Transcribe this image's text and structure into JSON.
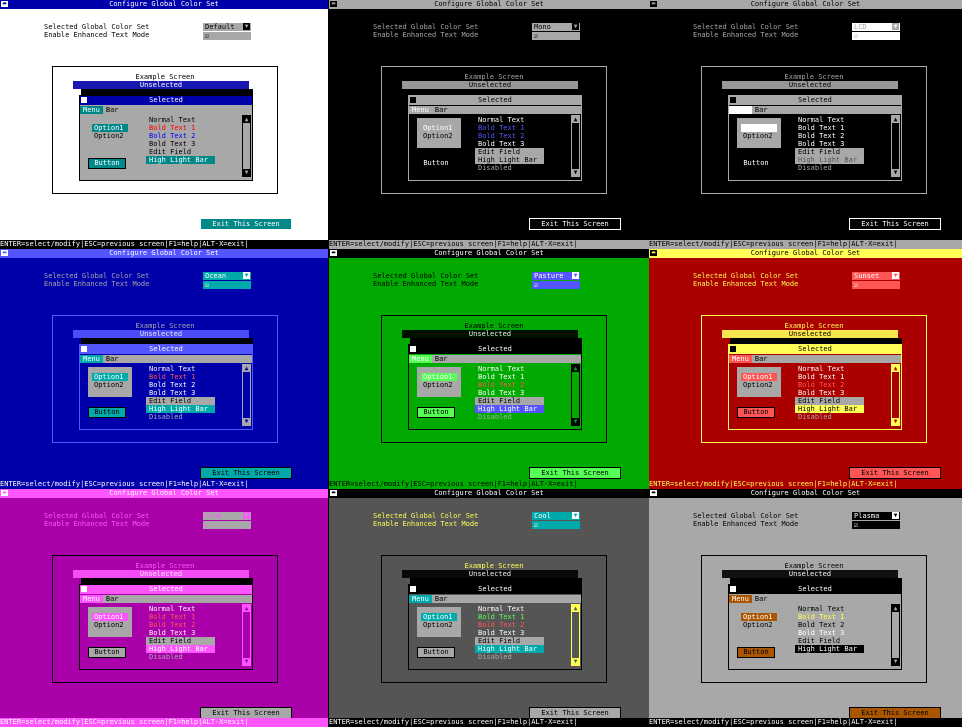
{
  "title": "Configure Global Color Set",
  "labels": {
    "selected_set": "Selected Global Color Set",
    "enhanced_mode": "Enable Enhanced Text Mode"
  },
  "example_title": "Example Screen",
  "unselected_title": "Unselected",
  "selected_title": "Selected",
  "menu_items": [
    "Menu",
    "Bar"
  ],
  "radio_options": [
    "Option1",
    "Option2"
  ],
  "button_label": "Button",
  "list_items": [
    "Normal Text",
    "Bold Text 1",
    "Bold Text 2",
    "Bold Text 3",
    "Edit Field",
    "High Light Bar",
    "Disabled"
  ],
  "check_mark": "☑",
  "exit_label": "Exit This Screen",
  "status_text": "ENTER=select/modify|ESC=previous screen|F1=help|ALT-X=exit|",
  "icons": {
    "dropdown": "chevron-down-icon",
    "system_menu": "system-menu-icon",
    "scroll_up": "arrow-up-icon",
    "scroll_down": "arrow-down-icon"
  },
  "panels": [
    {
      "name": "default",
      "value": "Default",
      "bg": "#ffffff",
      "fg": "#000000",
      "title_bg": "#0000aa",
      "title_fg": "#ffffff",
      "sel_bg": "#a8a8a8",
      "sel_fg": "#000000",
      "win_bg": "#a8a8a8",
      "win_title_bg": "#0000aa",
      "accent": "#008888",
      "list_fg": "#000000",
      "bold": "#ff0000",
      "bold2": "#0000ff",
      "bold3": "#000000",
      "hl_bg": "#008888",
      "hl_fg": "#ffffff",
      "exit_bg": "#008888",
      "exit_fg": "#ffffff",
      "status_bg": "#000000",
      "status_fg": "#ffffff",
      "border": "#000000"
    },
    {
      "name": "mono",
      "value": "Mono",
      "bg": "#000000",
      "fg": "#a8a8a8",
      "title_bg": "#a8a8a8",
      "title_fg": "#000000",
      "sel_bg": "#a8a8a8",
      "sel_fg": "#000000",
      "win_bg": "#000000",
      "win_title_bg": "#a8a8a8",
      "accent": "#a8a8a8",
      "list_fg": "#ffffff",
      "bold": "#5555ff",
      "bold2": "#5555ff",
      "bold3": "#ffffff",
      "hl_bg": "#a8a8a8",
      "hl_fg": "#000000",
      "exit_bg": "#000000",
      "exit_fg": "#ffffff",
      "status_bg": "#a8a8a8",
      "status_fg": "#000000",
      "border": "#a8a8a8"
    },
    {
      "name": "lcd",
      "value": "LCD",
      "bg": "#000000",
      "fg": "#a8a8a8",
      "title_bg": "#a8a8a8",
      "title_fg": "#000000",
      "sel_bg": "#ffffff",
      "sel_fg": "#a8a8a8",
      "win_bg": "#000000",
      "win_title_bg": "#a8a8a8",
      "accent": "#ffffff",
      "list_fg": "#ffffff",
      "bold": "#ffffff",
      "bold2": "#ffffff",
      "bold3": "#ffffff",
      "hl_bg": "#a8a8a8",
      "hl_fg": "#555555",
      "exit_bg": "#000000",
      "exit_fg": "#ffffff",
      "status_bg": "#a8a8a8",
      "status_fg": "#000000",
      "border": "#a8a8a8"
    },
    {
      "name": "ocean",
      "value": "Ocean",
      "bg": "#0000aa",
      "fg": "#a8a8a8",
      "title_bg": "#5555ff",
      "title_fg": "#ffffff",
      "sel_bg": "#00aaaa",
      "sel_fg": "#ffffff",
      "win_bg": "#0000aa",
      "win_title_bg": "#5555ff",
      "accent": "#00aaaa",
      "list_fg": "#ffffff",
      "bold": "#ff5555",
      "bold2": "#ffffff",
      "bold3": "#ffffff",
      "hl_bg": "#00aaaa",
      "hl_fg": "#ffffff",
      "exit_bg": "#00aaaa",
      "exit_fg": "#000000",
      "status_bg": "#0000aa",
      "status_fg": "#ffffff",
      "border": "#5555ff"
    },
    {
      "name": "pasture",
      "value": "Pasture",
      "bg": "#00aa00",
      "fg": "#000000",
      "title_bg": "#000000",
      "title_fg": "#ffffff",
      "sel_bg": "#5555ff",
      "sel_fg": "#ffffff",
      "win_bg": "#00aa00",
      "win_title_bg": "#000000",
      "accent": "#55ff55",
      "list_fg": "#ffffff",
      "bold": "#ffffff",
      "bold2": "#ff5555",
      "bold3": "#ffffff",
      "hl_bg": "#5555ff",
      "hl_fg": "#ffffff",
      "exit_bg": "#55ff55",
      "exit_fg": "#000000",
      "status_bg": "#00aa00",
      "status_fg": "#000000",
      "border": "#000000"
    },
    {
      "name": "sunset",
      "value": "Sunset",
      "bg": "#aa0000",
      "fg": "#ffff55",
      "title_bg": "#ffff55",
      "title_fg": "#000000",
      "sel_bg": "#ff5555",
      "sel_fg": "#ffffff",
      "win_bg": "#aa0000",
      "win_title_bg": "#ffff55",
      "accent": "#ff5555",
      "list_fg": "#ffffff",
      "bold": "#ffffff",
      "bold2": "#ff5555",
      "bold3": "#ffffff",
      "hl_bg": "#ffff55",
      "hl_fg": "#000000",
      "exit_bg": "#ff5555",
      "exit_fg": "#000000",
      "status_bg": "#aa0000",
      "status_fg": "#ffff55",
      "border": "#ffff55"
    },
    {
      "name": "pink",
      "value": "Pink",
      "bg": "#aa00aa",
      "fg": "#ff55ff",
      "title_bg": "#ff55ff",
      "title_fg": "#ffffff",
      "sel_bg": "#a8a8a8",
      "sel_fg": "#ff55ff",
      "win_bg": "#aa00aa",
      "win_title_bg": "#ff55ff",
      "accent": "#ff55ff",
      "list_fg": "#ffffff",
      "bold": "#ff5555",
      "bold2": "#ff5555",
      "bold3": "#ffffff",
      "hl_bg": "#ff55ff",
      "hl_fg": "#ffffff",
      "exit_bg": "#a8a8a8",
      "exit_fg": "#000000",
      "status_bg": "#ff55ff",
      "status_fg": "#ffffff",
      "border": "#000000"
    },
    {
      "name": "cool",
      "value": "Cool",
      "bg": "#555555",
      "fg": "#ffff55",
      "title_bg": "#000000",
      "title_fg": "#ffffff",
      "sel_bg": "#00aaaa",
      "sel_fg": "#ffffff",
      "win_bg": "#555555",
      "win_title_bg": "#000000",
      "accent": "#00aaaa",
      "list_fg": "#ffffff",
      "bold": "#55ff55",
      "bold2": "#ff5555",
      "bold3": "#ffffff",
      "hl_bg": "#00aaaa",
      "hl_fg": "#ffffff",
      "exit_bg": "#a8a8a8",
      "exit_fg": "#000000",
      "status_bg": "#000000",
      "status_fg": "#ffffff",
      "border": "#000000"
    },
    {
      "name": "plasma",
      "value": "Plasma",
      "bg": "#a8a8a8",
      "fg": "#000000",
      "title_bg": "#000000",
      "title_fg": "#ffffff",
      "sel_bg": "#000000",
      "sel_fg": "#ffffff",
      "win_bg": "#a8a8a8",
      "win_title_bg": "#000000",
      "accent": "#aa5500",
      "list_fg": "#000000",
      "bold": "#ffff55",
      "bold2": "#000000",
      "bold3": "#ffffff",
      "hl_bg": "#000000",
      "hl_fg": "#ffffff",
      "exit_bg": "#aa5500",
      "exit_fg": "#000000",
      "status_bg": "#000000",
      "status_fg": "#ffffff",
      "border": "#000000"
    }
  ]
}
